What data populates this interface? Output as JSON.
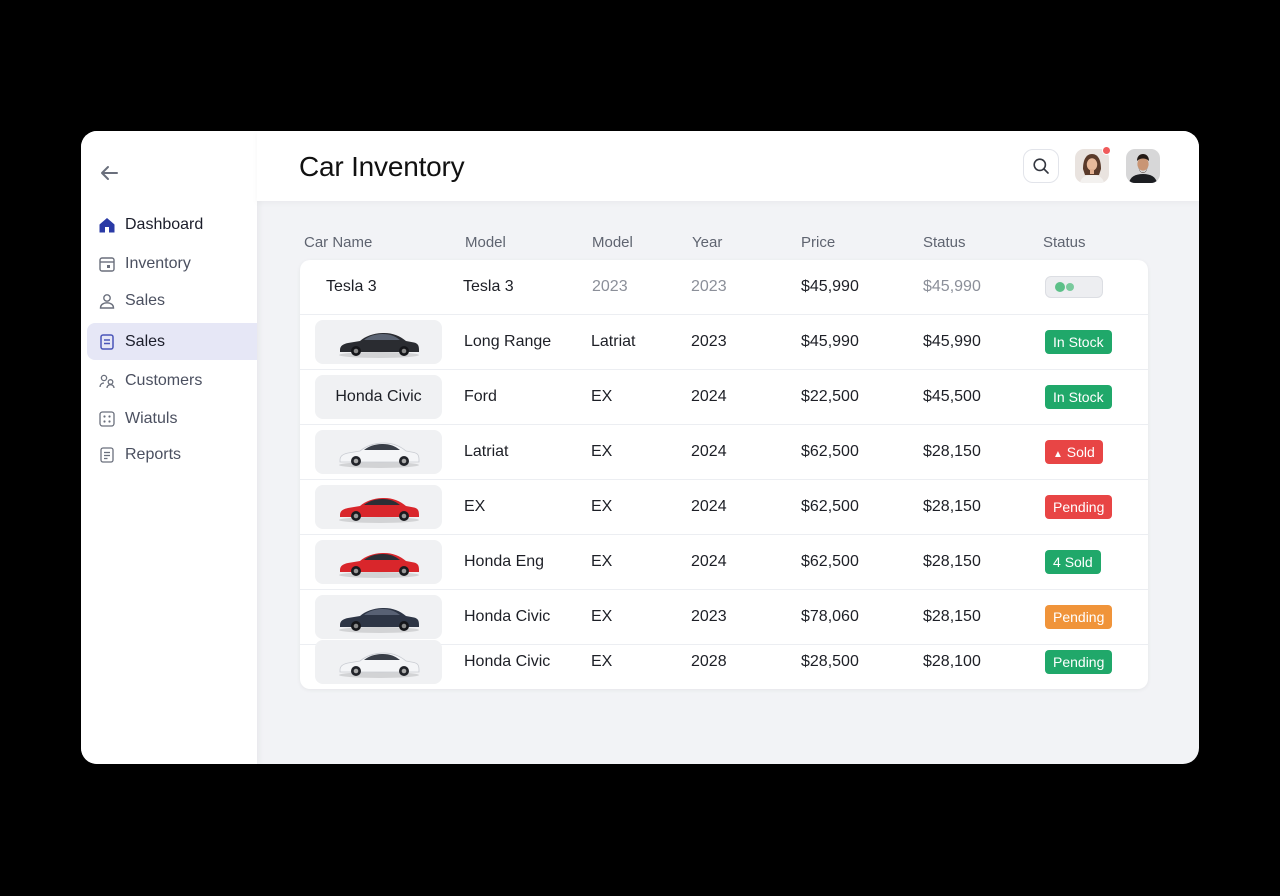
{
  "title": "Car Inventory",
  "sidebar": {
    "items": [
      {
        "label": "Dashboard",
        "icon": "home-icon"
      },
      {
        "label": "Inventory",
        "icon": "calendar-icon"
      },
      {
        "label": "Sales",
        "icon": "user-icon"
      },
      {
        "label": "Sales",
        "icon": "document-icon"
      },
      {
        "label": "Customers",
        "icon": "people-icon"
      },
      {
        "label": "Wiatuls",
        "icon": "grid-icon"
      },
      {
        "label": "Reports",
        "icon": "report-icon"
      }
    ]
  },
  "columns": [
    "Car Name",
    "Model",
    "Model",
    "Year",
    "Price",
    "Status",
    "Status"
  ],
  "rows": [
    {
      "name": "Tesla 3",
      "model": "Tesla 3",
      "model2": "2023",
      "year": "2023",
      "price": "$45,990",
      "status": "$45,990",
      "badge": ""
    },
    {
      "name": "",
      "model": "Long Range",
      "model2": "Latriat",
      "year": "2023",
      "price": "$45,990",
      "status": "$45,990",
      "badge": "In Stock"
    },
    {
      "name": "Honda Civic",
      "model": "Ford",
      "model2": "EX",
      "year": "2024",
      "price": "$22,500",
      "status": "$45,500",
      "badge": "In Stock"
    },
    {
      "name": "",
      "model": "Latriat",
      "model2": "EX",
      "year": "2024",
      "price": "$62,500",
      "status": "$28,150",
      "badge": "Sold",
      "badge_glyph": "▲"
    },
    {
      "name": "",
      "model": "EX",
      "model2": "EX",
      "year": "2024",
      "price": "$62,500",
      "status": "$28,150",
      "badge": "Pending"
    },
    {
      "name": "",
      "model": "Honda Eng",
      "model2": "EX",
      "year": "2024",
      "price": "$62,500",
      "status": "$28,150",
      "badge": "Sold",
      "badge_glyph": "4"
    },
    {
      "name": "",
      "model": "Honda Civic",
      "model2": "EX",
      "year": "2023",
      "price": "$78,060",
      "status": "$28,150",
      "badge": "Pending"
    },
    {
      "name": "",
      "model": "Honda Civic",
      "model2": "EX",
      "year": "2028",
      "price": "$28,500",
      "status": "$28,100",
      "badge": "Pending"
    }
  ],
  "colors": {
    "green": "#20a86a",
    "red": "#e84545",
    "orange": "#f0943a",
    "car_black": "#2a2c31",
    "car_white": "#f4f5f7",
    "car_red": "#d9262b",
    "car_navy": "#2d3545"
  }
}
